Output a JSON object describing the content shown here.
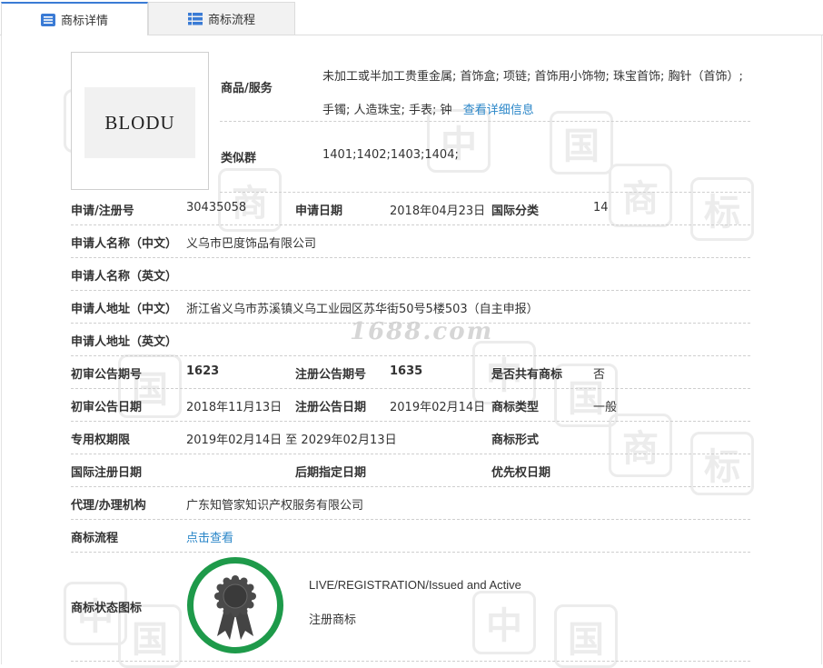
{
  "tabs": [
    {
      "label": "商标详情",
      "icon": "list-icon"
    },
    {
      "label": "商标流程",
      "icon": "grid-list-icon"
    }
  ],
  "logo": {
    "text": "BLODU"
  },
  "watermark": {
    "text": "1688.com",
    "char1": "中",
    "char2": "国",
    "char3": "商",
    "char4": "标"
  },
  "goods": {
    "label": "商品/服务",
    "value": "未加工或半加工贵重金属; 首饰盒; 项链; 首饰用小饰物; 珠宝首饰; 胸针（首饰）; 手镯; 人造珠宝; 手表; 钟",
    "link": "查看详细信息"
  },
  "similar": {
    "label": "类似群",
    "value": "1401;1402;1403;1404;"
  },
  "reg_no": {
    "label": "申请/注册号",
    "value": "30435058"
  },
  "apply_date": {
    "label": "申请日期",
    "value": "2018年04月23日"
  },
  "intl_class": {
    "label": "国际分类",
    "value": "14"
  },
  "applicant_cn": {
    "label": "申请人名称（中文）",
    "value": "义乌市巴度饰品有限公司"
  },
  "applicant_en": {
    "label": "申请人名称（英文）",
    "value": ""
  },
  "address_cn": {
    "label": "申请人地址（中文）",
    "value": "浙江省义乌市苏溪镇义乌工业园区苏华街50号5楼503（自主申报）"
  },
  "address_en": {
    "label": "申请人地址（英文）",
    "value": ""
  },
  "prelim_no": {
    "label": "初审公告期号",
    "value": "1623"
  },
  "reg_notice_no": {
    "label": "注册公告期号",
    "value": "1635"
  },
  "shared": {
    "label": "是否共有商标",
    "value": "否"
  },
  "prelim_date": {
    "label": "初审公告日期",
    "value": "2018年11月13日"
  },
  "reg_notice_date": {
    "label": "注册公告日期",
    "value": "2019年02月14日"
  },
  "tm_type": {
    "label": "商标类型",
    "value": "一般"
  },
  "exclusive": {
    "label": "专用权期限",
    "value": "2019年02月14日 至 2029年02月13日"
  },
  "tm_form": {
    "label": "商标形式",
    "value": ""
  },
  "intl_reg_date": {
    "label": "国际注册日期",
    "value": ""
  },
  "late_designation": {
    "label": "后期指定日期",
    "value": ""
  },
  "priority_date": {
    "label": "优先权日期",
    "value": ""
  },
  "agent": {
    "label": "代理/办理机构",
    "value": "广东知管家知识产权服务有限公司"
  },
  "process": {
    "label": "商标流程",
    "link": "点击查看"
  },
  "status": {
    "label": "商标状态图标",
    "line1": "LIVE/REGISTRATION/Issued and Active",
    "line2": "注册商标",
    "icon": "award-ribbon-icon",
    "ring_color": "#1e9a4a"
  },
  "colors": {
    "link": "#2a86c8",
    "tab_accent": "#3a7bd5"
  }
}
